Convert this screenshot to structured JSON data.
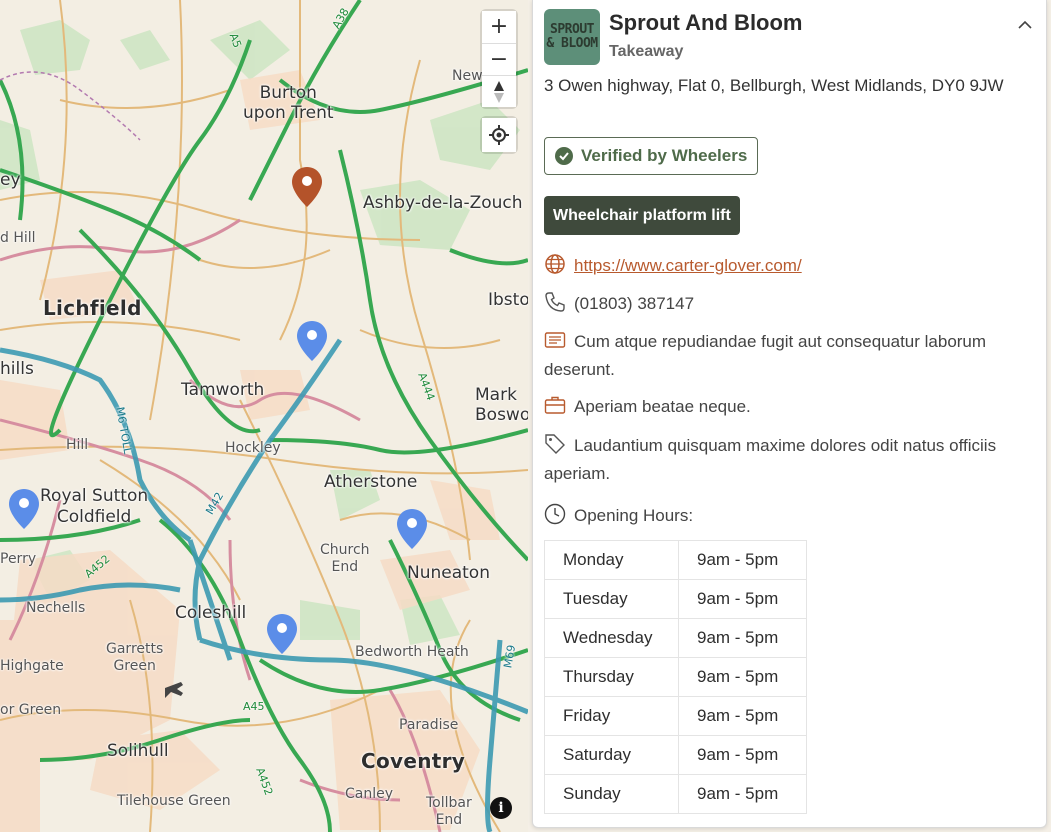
{
  "map": {
    "places": {
      "burton": "Burton\nupon Trent",
      "ashby": "Ashby-de-la-Zouch",
      "lichfield": "Lichfield",
      "tamworth": "Tamworth",
      "hockley": "Hockley",
      "atherstone": "Atherstone",
      "royal_sutton": "Royal Sutton\nColdfield",
      "church_end": "Church\nEnd",
      "nuneaton": "Nuneaton",
      "coleshill": "Coleshill",
      "bedworth_heath": "Bedworth Heath",
      "garretts_green": "Garretts\nGreen",
      "nechells": "Nechells",
      "solihull": "Solihull",
      "coventry": "Coventry",
      "paradise": "Paradise",
      "canley": "Canley",
      "tollbar_end": "Tollbar\nEnd",
      "tilehouse": "Tilehouse Green",
      "highgate": "Highgate",
      "or_green": "or Green",
      "hill": "Hill",
      "d_hill": "d Hill",
      "hills": "hills",
      "perry": "Perry",
      "ey": "ey",
      "newt": "New",
      "ibsto": "Ibsto",
      "mark_bosw": "Mark\nBoswo"
    },
    "roads": {
      "a38": "A38",
      "a5": "A5",
      "a444": "A444",
      "m6toll": "M6 TOLL",
      "m42": "M42",
      "a452": "A452",
      "a45": "A45",
      "a45b": "A452",
      "m69": "M69"
    },
    "controls": {
      "zoom_in": "+",
      "zoom_out": "−",
      "info": "i"
    },
    "colors": {
      "selected_pin": "#b4532a",
      "pin": "#5b8de8"
    }
  },
  "panel": {
    "logo_line1": "SPROUT",
    "logo_line2": "& BLOOM",
    "name": "Sprout And Bloom",
    "category": "Takeaway",
    "address": "3 Owen highway, Flat 0, Bellburgh, West Midlands, DY0 9JW",
    "verified": "Verified by Wheelers",
    "feature_tag": "Wheelchair platform lift",
    "website": "https://www.carter-glover.com/",
    "phone": "(01803) 387147",
    "description": "Cum atque repudiandae fugit aut consequatur laborum deserunt.",
    "business": "Aperiam beatae neque.",
    "tags": "Laudantium quisquam maxime dolores odit natus officiis aperiam.",
    "hours_label": "Opening Hours:",
    "hours": [
      {
        "day": "Monday",
        "time": "9am - 5pm"
      },
      {
        "day": "Tuesday",
        "time": "9am - 5pm"
      },
      {
        "day": "Wednesday",
        "time": "9am - 5pm"
      },
      {
        "day": "Thursday",
        "time": "9am - 5pm"
      },
      {
        "day": "Friday",
        "time": "9am - 5pm"
      },
      {
        "day": "Saturday",
        "time": "9am - 5pm"
      },
      {
        "day": "Sunday",
        "time": "9am - 5pm"
      }
    ],
    "accent": "#b85a2e"
  }
}
